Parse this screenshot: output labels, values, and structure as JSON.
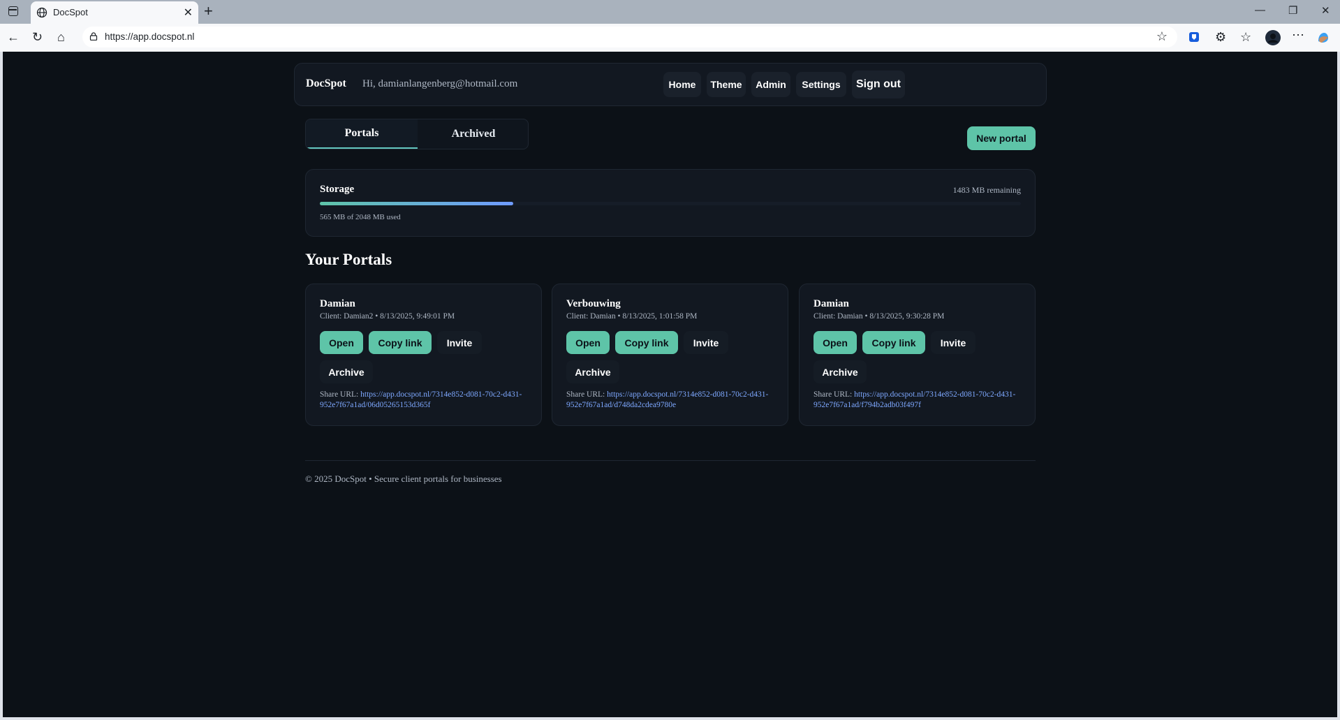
{
  "browser": {
    "tab_title": "DocSpot",
    "url": "https://app.docspot.nl"
  },
  "header": {
    "brand": "DocSpot",
    "greeting": "Hi, damianlangenberg@hotmail.com",
    "nav": [
      "Home",
      "Theme",
      "Admin",
      "Settings",
      "Sign out"
    ]
  },
  "tabs": {
    "portals": "Portals",
    "archived": "Archived"
  },
  "new_portal_label": "New portal",
  "storage": {
    "title": "Storage",
    "remaining": "1483 MB remaining",
    "used_text": "565 MB of 2048 MB used",
    "used_fraction": 0.276
  },
  "section_title": "Your Portals",
  "portals": [
    {
      "name": "Damian",
      "meta": "Client: Damian2 • 8/13/2025, 9:49:01 PM",
      "share_prefix": "Share URL: ",
      "share_url": "https://app.docspot.nl/7314e852-d081-70c2-d431-952e7f67a1ad/06d05265153d365f"
    },
    {
      "name": "Verbouwing",
      "meta": "Client: Damian • 8/13/2025, 1:01:58 PM",
      "share_prefix": "Share URL: ",
      "share_url": "https://app.docspot.nl/7314e852-d081-70c2-d431-952e7f67a1ad/d748da2cdea9780e"
    },
    {
      "name": "Damian",
      "meta": "Client: Damian • 8/13/2025, 9:30:28 PM",
      "share_prefix": "Share URL: ",
      "share_url": "https://app.docspot.nl/7314e852-d081-70c2-d431-952e7f67a1ad/f794b2adb03f497f"
    }
  ],
  "card_buttons": {
    "open": "Open",
    "copy": "Copy link",
    "invite": "Invite",
    "archive": "Archive"
  },
  "footer": "© 2025 DocSpot • Secure client portals for businesses",
  "colors": {
    "accent": "#5ec4a8",
    "link": "#7ea8ff",
    "page_bg": "#0c1117"
  }
}
